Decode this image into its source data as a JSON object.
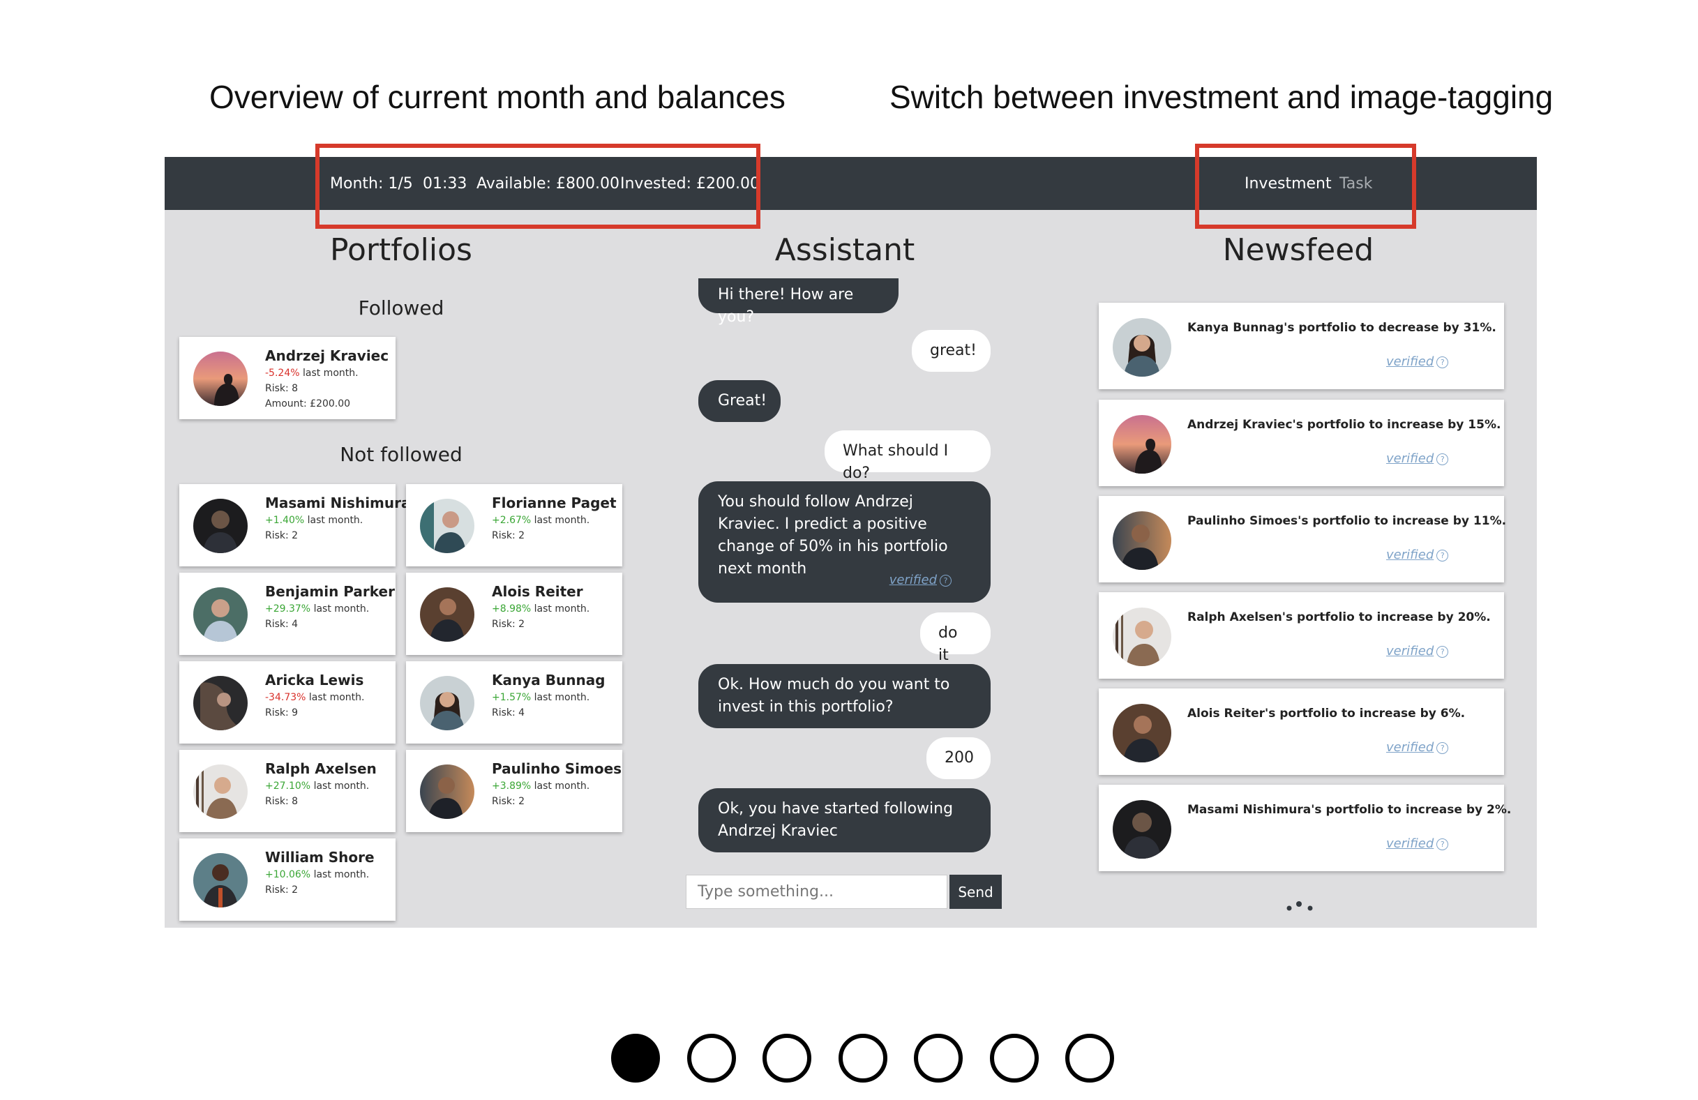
{
  "captions": {
    "left": "Overview of current month and balances",
    "right": "Switch between investment and image-tagging"
  },
  "navbar": {
    "month": "Month: 1/5",
    "clock": "01:33",
    "available": "Available: £800.00",
    "invested": "Invested: £200.00",
    "tabs": {
      "investment": "Investment",
      "task": "Task"
    }
  },
  "colors": {
    "highlight": "#d63a2b",
    "navbar": "#343a40",
    "positive": "#3aa635",
    "negative": "#d9312b",
    "verified_link": "#7fa3c8"
  },
  "portfolios": {
    "title": "Portfolios",
    "followed_title": "Followed",
    "not_followed_title": "Not followed",
    "followed": [
      {
        "name": "Andrzej Kraviec",
        "change": "-5.24%",
        "change_suffix": " last month.",
        "risk": "Risk: 8",
        "amount": "Amount: £200.00"
      }
    ],
    "not_followed": [
      {
        "name": "Masami Nishimura",
        "change": "+1.40%",
        "change_suffix": " last month.",
        "risk": "Risk: 2"
      },
      {
        "name": "Florianne Paget",
        "change": "+2.67%",
        "change_suffix": " last month.",
        "risk": "Risk: 2"
      },
      {
        "name": "Benjamin Parker",
        "change": "+29.37%",
        "change_suffix": " last month.",
        "risk": "Risk: 4"
      },
      {
        "name": "Alois Reiter",
        "change": "+8.98%",
        "change_suffix": " last month.",
        "risk": "Risk: 2"
      },
      {
        "name": "Aricka Lewis",
        "change": "-34.73%",
        "change_suffix": " last month.",
        "risk": "Risk: 9"
      },
      {
        "name": "Kanya Bunnag",
        "change": "+1.57%",
        "change_suffix": " last month.",
        "risk": "Risk: 4"
      },
      {
        "name": "Ralph Axelsen",
        "change": "+27.10%",
        "change_suffix": " last month.",
        "risk": "Risk: 8"
      },
      {
        "name": "Paulinho Simoes",
        "change": "+3.89%",
        "change_suffix": " last month.",
        "risk": "Risk: 2"
      },
      {
        "name": "William Shore",
        "change": "+10.06%",
        "change_suffix": " last month.",
        "risk": "Risk: 2"
      }
    ]
  },
  "assistant": {
    "title": "Assistant",
    "messages": [
      {
        "from": "bot",
        "text": "Hi there! How are you?"
      },
      {
        "from": "user",
        "text": "great!"
      },
      {
        "from": "bot",
        "text": "Great!"
      },
      {
        "from": "user",
        "text": "What should I do?"
      },
      {
        "from": "bot",
        "text": "You should follow Andrzej Kraviec. I predict a positive change of 50% in his portfolio next month",
        "verified": "verified"
      },
      {
        "from": "user",
        "text": "do it"
      },
      {
        "from": "bot",
        "text": "Ok. How much do you want to invest in this portfolio?"
      },
      {
        "from": "user",
        "text": "200"
      },
      {
        "from": "bot",
        "text": "Ok, you have started following Andrzej Kraviec"
      }
    ],
    "input_placeholder": "Type something...",
    "send_label": "Send"
  },
  "newsfeed": {
    "title": "Newsfeed",
    "items": [
      {
        "text": "Kanya Bunnag's portfolio to decrease by 31%.",
        "verified": "verified"
      },
      {
        "text": "Andrzej Kraviec's portfolio to increase by 15%.",
        "verified": "verified"
      },
      {
        "text": "Paulinho Simoes's portfolio to increase by 11%.",
        "verified": "verified"
      },
      {
        "text": "Ralph Axelsen's portfolio to increase by 20%.",
        "verified": "verified"
      },
      {
        "text": "Alois Reiter's portfolio to increase by 6%.",
        "verified": "verified"
      },
      {
        "text": "Masami Nishimura's portfolio to increase by 2%.",
        "verified": "verified"
      }
    ],
    "help_icon": "?"
  },
  "pager": {
    "total": 7,
    "active_index": 1
  }
}
